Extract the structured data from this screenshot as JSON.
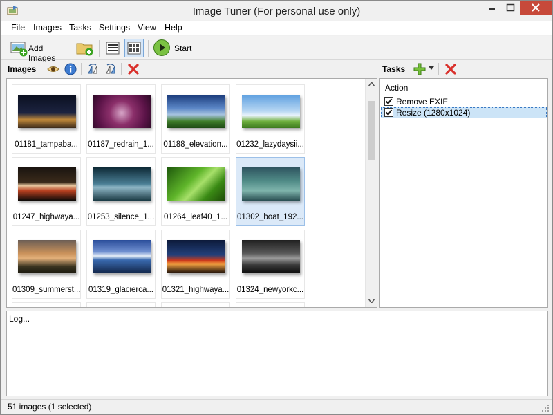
{
  "window": {
    "title": "Image Tuner (For personal use only)"
  },
  "menu": [
    "File",
    "Images",
    "Tasks",
    "Settings",
    "View",
    "Help"
  ],
  "toolbar": {
    "add_images_label": "Add Images",
    "start_label": "Start"
  },
  "images_pane": {
    "title": "Images",
    "items": [
      {
        "name": "01181_tampaba...",
        "selected": false
      },
      {
        "name": "01187_redrain_1...",
        "selected": false
      },
      {
        "name": "01188_elevation...",
        "selected": false
      },
      {
        "name": "01232_lazydaysii...",
        "selected": false
      },
      {
        "name": "01247_highwaya...",
        "selected": false
      },
      {
        "name": "01253_silence_1...",
        "selected": false
      },
      {
        "name": "01264_leaf40_1...",
        "selected": false
      },
      {
        "name": "01302_boat_192...",
        "selected": true
      },
      {
        "name": "01309_summerst...",
        "selected": false
      },
      {
        "name": "01319_glacierca...",
        "selected": false
      },
      {
        "name": "01321_highwaya...",
        "selected": false
      },
      {
        "name": "01324_newyorkc...",
        "selected": false
      }
    ]
  },
  "tasks_pane": {
    "title": "Tasks",
    "column_header": "Action",
    "items": [
      {
        "label": "Remove EXIF",
        "checked": true,
        "selected": false
      },
      {
        "label": "Resize (1280x1024)",
        "checked": true,
        "selected": true
      }
    ]
  },
  "log": {
    "placeholder": "Log..."
  },
  "status": {
    "text": "51 images (1 selected)"
  },
  "colors": {
    "close_button": "#c7493a",
    "selection": "#dbe9f8",
    "accent_green": "#3aa321",
    "delete_red": "#d9302b"
  }
}
